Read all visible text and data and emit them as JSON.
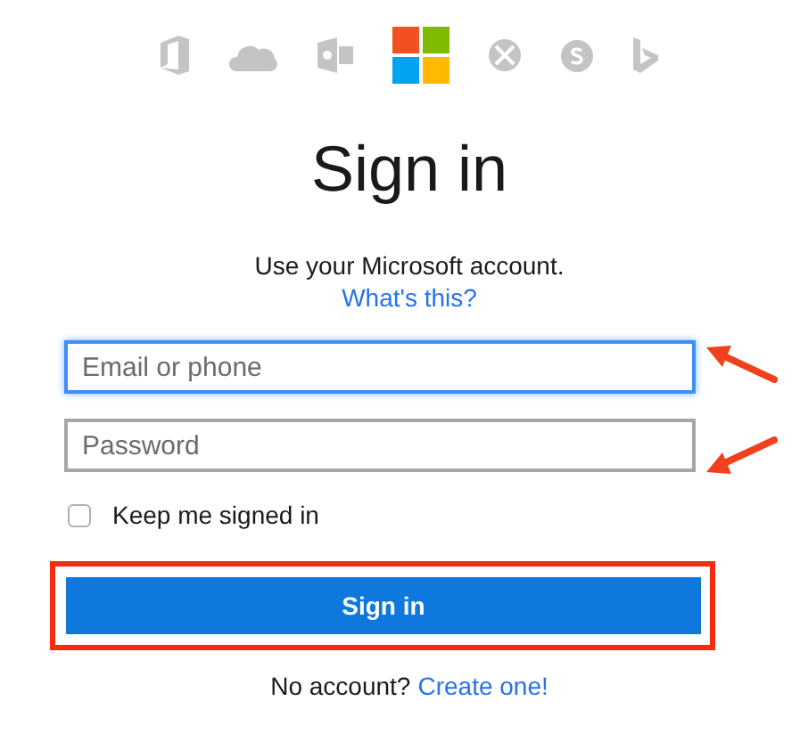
{
  "title": "Sign in",
  "intro": {
    "text": "Use your Microsoft account.",
    "link": "What's this?"
  },
  "fields": [
    {
      "placeholder": "Email or phone",
      "focused": true,
      "annotated": true
    },
    {
      "placeholder": "Password",
      "focused": false,
      "annotated": true
    }
  ],
  "keep_signed_in": {
    "label": "Keep me signed in",
    "checked": false
  },
  "submit": {
    "label": "Sign in",
    "highlighted": true
  },
  "footer": {
    "text": "No account?",
    "link": "Create one!"
  }
}
